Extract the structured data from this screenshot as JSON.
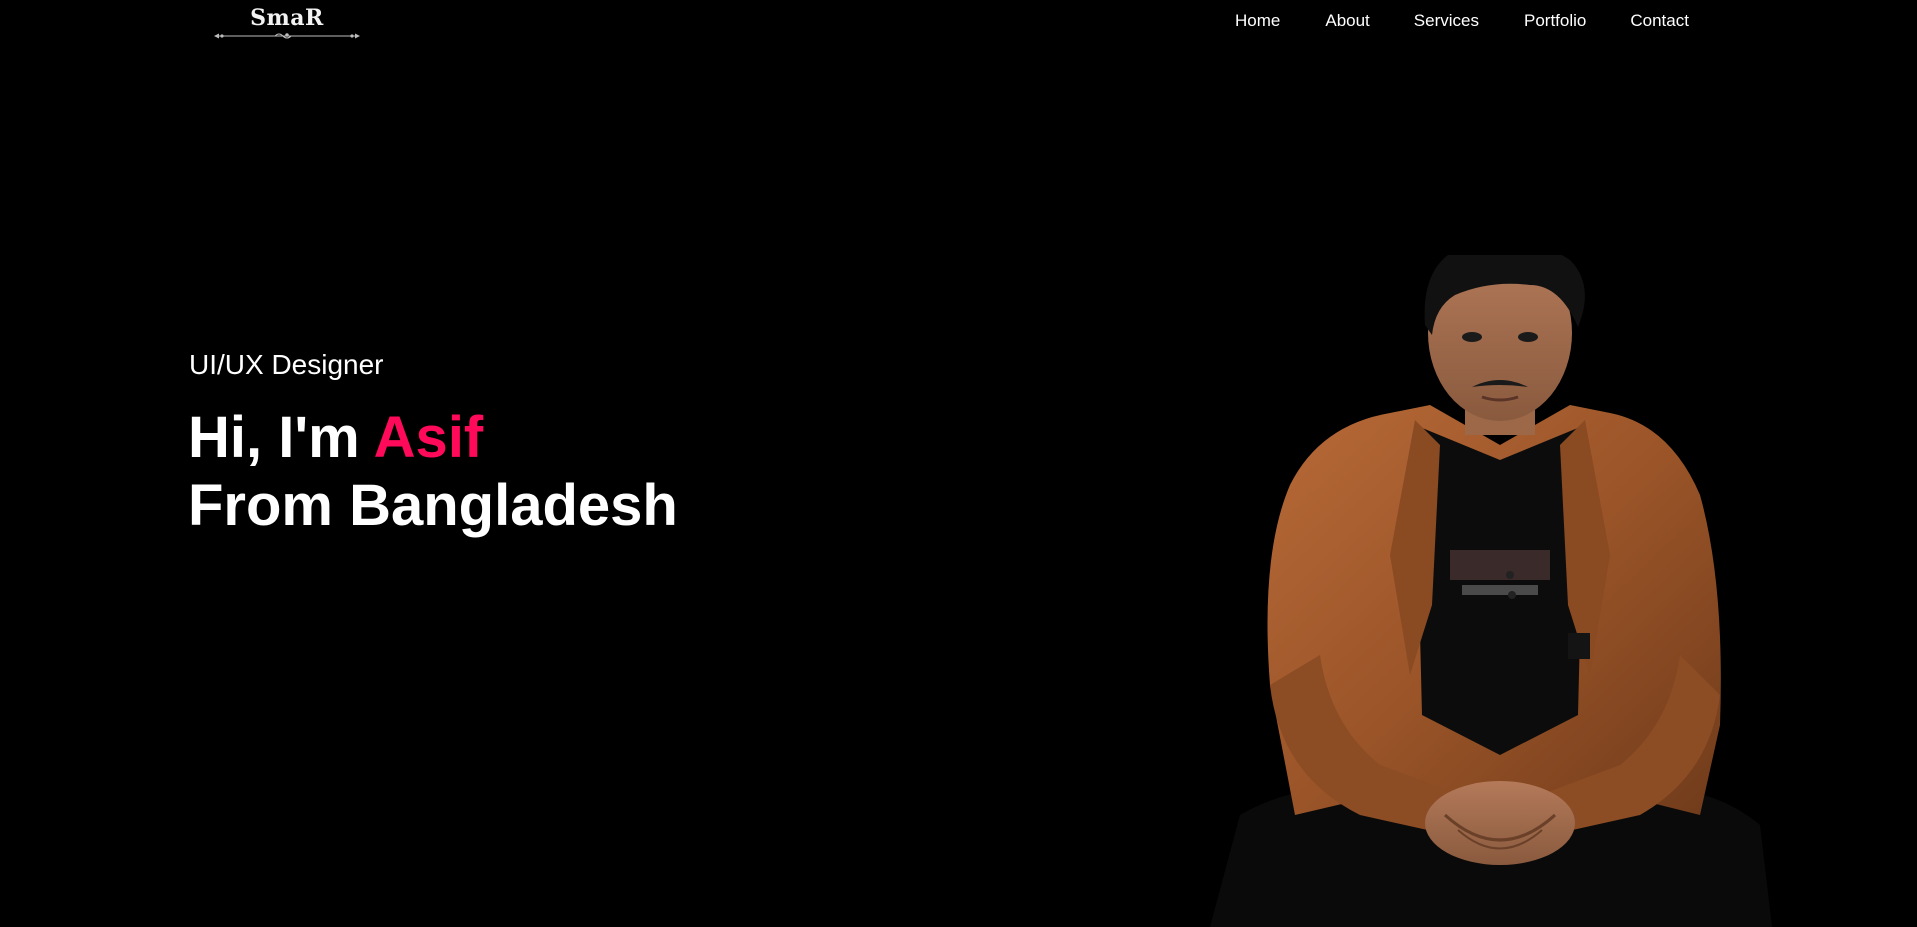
{
  "header": {
    "logo": {
      "text": "SmaR",
      "icon": "ornamental-divider-icon"
    },
    "nav": {
      "home": "Home",
      "about": "About",
      "services": "Services",
      "portfolio": "Portfolio",
      "contact": "Contact"
    }
  },
  "hero": {
    "subtitle": "UI/UX Designer",
    "greeting": "Hi, I'm ",
    "name": "Asif",
    "location_line": "From Bangladesh",
    "portrait": "profile-photo"
  },
  "colors": {
    "background": "#000000",
    "text": "#ffffff",
    "accent": "#ff0a5a",
    "jacket": "#a0582c"
  }
}
